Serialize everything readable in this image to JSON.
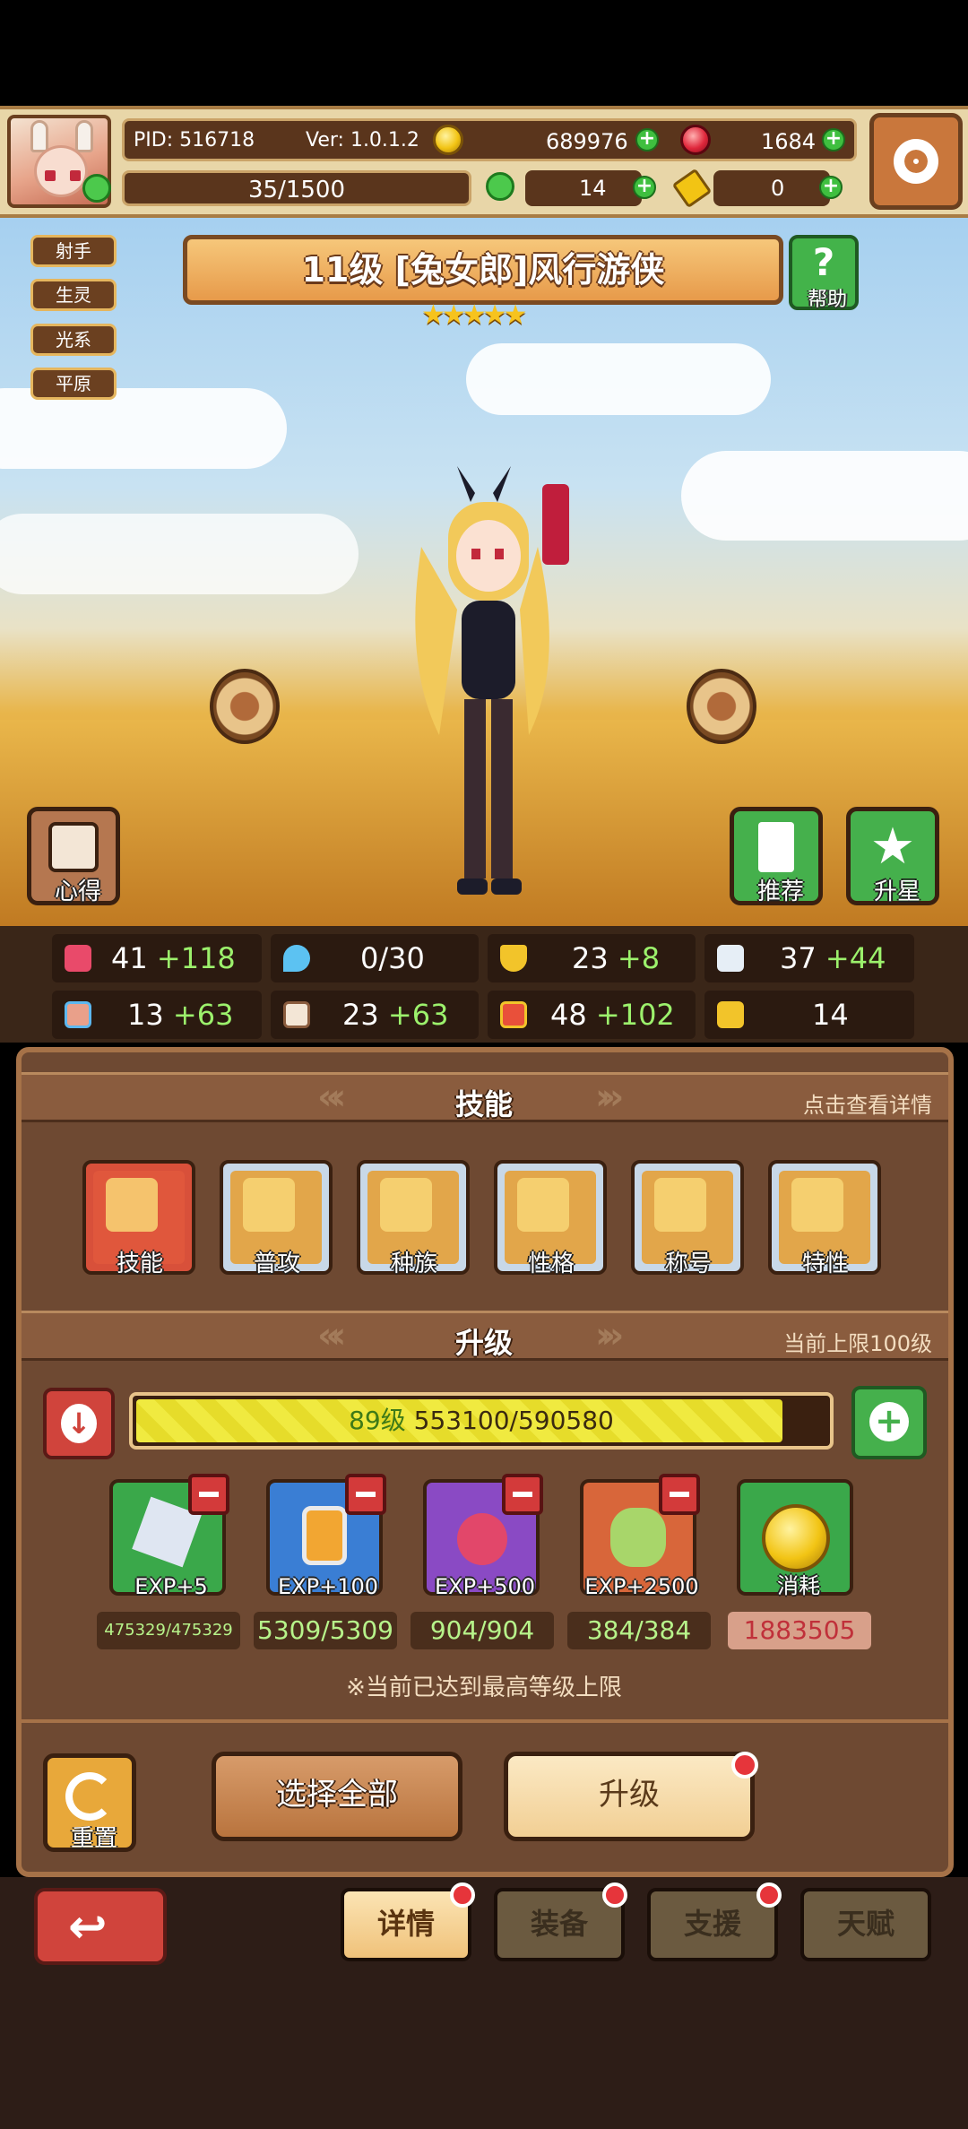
{
  "header": {
    "pid": "PID: 516718",
    "version": "Ver: 1.0.1.2",
    "gold": "689976",
    "gems": "1684",
    "energy": "35/1500",
    "clover": "14",
    "key": "0"
  },
  "tags": [
    "射手",
    "生灵",
    "光系",
    "平原"
  ],
  "hero": {
    "title": "11级 [兔女郎]风行游侠",
    "stars": "★★★★★",
    "help_label": "帮助"
  },
  "side_buttons": {
    "insight": "心得",
    "recommend": "推荐",
    "star_up": "升星"
  },
  "stats": [
    {
      "icon": "heart-icon",
      "base": "41",
      "bonus": "+118"
    },
    {
      "icon": "water-drop-icon",
      "base": "0/30",
      "bonus": ""
    },
    {
      "icon": "shield-icon",
      "base": "23",
      "bonus": "+8"
    },
    {
      "icon": "wing-icon",
      "base": "37",
      "bonus": "+44"
    },
    {
      "icon": "fist-icon",
      "base": "13",
      "bonus": "+63"
    },
    {
      "icon": "book-icon",
      "base": "23",
      "bonus": "+63"
    },
    {
      "icon": "flag-icon",
      "base": "48",
      "bonus": "+102"
    },
    {
      "icon": "crown-icon",
      "base": "14",
      "bonus": ""
    }
  ],
  "skills_section": {
    "title": "技能",
    "note": "点击查看详情",
    "items": [
      "技能",
      "普攻",
      "种族",
      "性格",
      "称号",
      "特性"
    ]
  },
  "upgrade_section": {
    "title": "升级",
    "note": "当前上限100级",
    "level": "89级",
    "exp": "553100/590580",
    "exp_fraction": 0.936
  },
  "materials": [
    {
      "label": "EXP+5",
      "count": "475329/475329",
      "color": "#3aa84a"
    },
    {
      "label": "EXP+100",
      "count": "5309/5309",
      "color": "#3a7ed4"
    },
    {
      "label": "EXP+500",
      "count": "904/904",
      "color": "#8a4ac4"
    },
    {
      "label": "EXP+2500",
      "count": "384/384",
      "color": "#d8663a"
    },
    {
      "label": "消耗",
      "count": "1883505",
      "color": "#3aa84a"
    }
  ],
  "notice": "※当前已达到最高等级上限",
  "actions": {
    "reset": "重置",
    "select_all": "选择全部",
    "upgrade": "升级"
  },
  "nav": {
    "back": "back-arrow-icon",
    "tabs": [
      "详情",
      "装备",
      "支援",
      "天赋"
    ]
  }
}
